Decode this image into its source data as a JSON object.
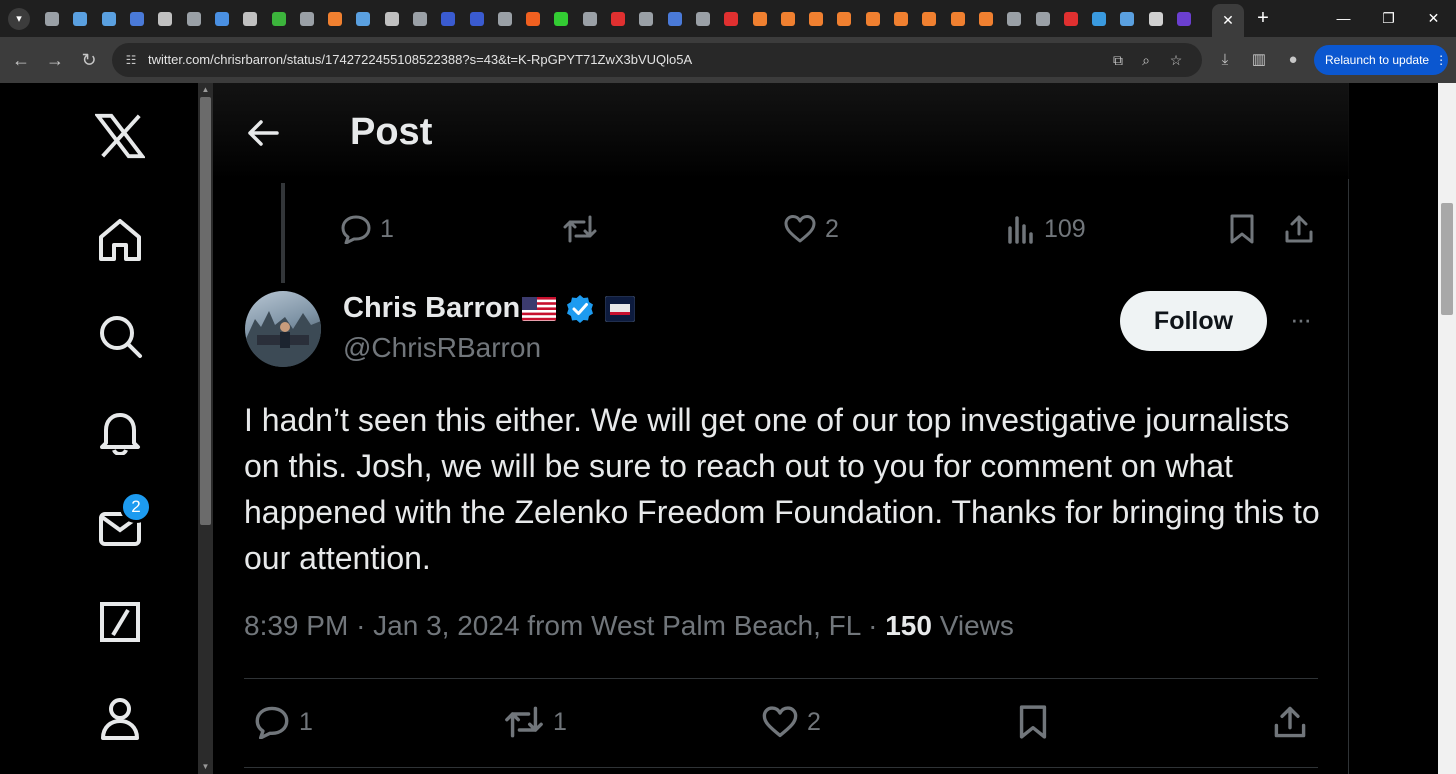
{
  "browser": {
    "url": "twitter.com/chrisrbarron/status/1742722455108522388?s=43&t=K-RpGPYT71ZwX3bVUQlo5A",
    "relaunch_label": "Relaunch to update",
    "relaunch_more": "⋮",
    "tab_close": "✕",
    "new_tab": "+",
    "window_controls": [
      "—",
      "❐",
      "✕"
    ],
    "favicon_colors": [
      "#9aa0a6",
      "#5aa0e0",
      "#5aa0e0",
      "#4a7ad8",
      "#c0c0c0",
      "#9aa0a6",
      "#4a90e2",
      "#c0c0c0",
      "#3cb43c",
      "#9aa0a6",
      "#f08030",
      "#5aa0e0",
      "#c0c0c0",
      "#9aa0a6",
      "#3a5bd0",
      "#3a5bd0",
      "#9aa0a6",
      "#f06020",
      "#33cc33",
      "#9aa0a6",
      "#e03030",
      "#9aa0a6",
      "#4a7ad8",
      "#9aa0a6",
      "#e03030",
      "#f08030",
      "#f08030",
      "#f08030",
      "#f08030",
      "#f08030",
      "#f08030",
      "#f08030",
      "#f08030",
      "#f08030",
      "#9aa0a6",
      "#9aa0a6",
      "#e03030",
      "#3a9adf",
      "#5aa0e0",
      "#d0d0d0",
      "#6b3fd0"
    ]
  },
  "nav": {
    "badge_count": "2"
  },
  "header": {
    "title": "Post"
  },
  "prev_tweet_actions": {
    "replies": "1",
    "reposts": "",
    "likes": "2",
    "views": "109"
  },
  "tweet": {
    "author_name": "Chris Barron",
    "handle": "@ChrisRBarron",
    "follow_label": "Follow",
    "more_label": "···",
    "text": "I hadn’t seen this either. We will get one of our top investigative journalists on this. Josh, we will be sure to reach out to you for comment on what happened with the Zelenko Freedom Foundation. Thanks for bringing this to our attention.",
    "time": "8:39 PM",
    "date": "Jan 3, 2024",
    "location": "from West Palm Beach, FL",
    "separator": "·",
    "views_count": "150",
    "views_label": "Views"
  },
  "tweet_actions": {
    "replies": "1",
    "reposts": "1",
    "likes": "2"
  },
  "colors": {
    "accent": "#1d9bf0",
    "muted": "#71767b",
    "text": "#e7e9ea",
    "relaunch": "#0b57d0"
  }
}
